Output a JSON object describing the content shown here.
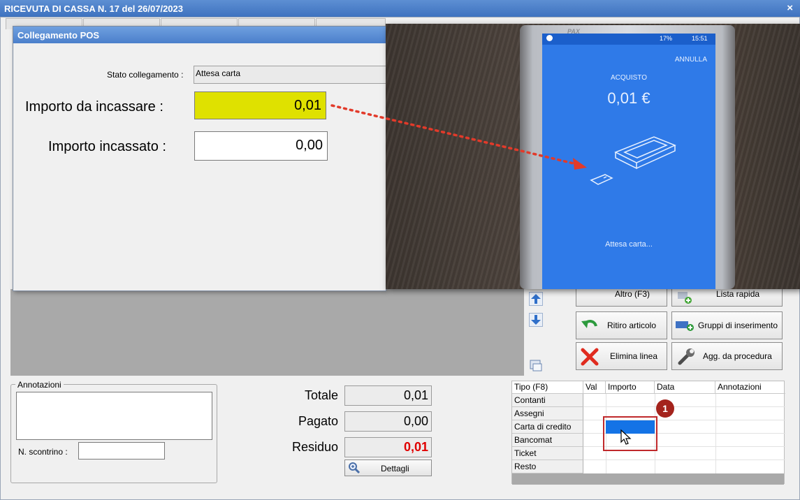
{
  "main_window": {
    "title": "RICEVUTA DI CASSA N. 17 del 26/07/2023",
    "close_glyph": "×"
  },
  "pos_dialog": {
    "title": "Collegamento POS",
    "stato_label": "Stato collegamento :",
    "stato_value": "Attesa carta",
    "importo_incassare_label": "Importo da incassare :",
    "importo_incassare_value": "0,01",
    "importo_incassato_label": "Importo incassato :",
    "importo_incassato_value": "0,00"
  },
  "phone": {
    "brand": "PAX",
    "status_time": "15:51",
    "status_battery": "17%",
    "annulla": "ANNULLA",
    "acquisto": "ACQUISTO",
    "amount": "0,01 €",
    "waiting": "Attesa carta..."
  },
  "buttons": {
    "altro": "Altro (F3)",
    "lista_rapida": "Lista rapida",
    "ritiro_articolo": "Ritiro articolo",
    "gruppi": "Gruppi di inserimento",
    "elimina_linea": "Elimina linea",
    "agg_procedura": "Agg. da procedura",
    "dettagli": "Dettagli"
  },
  "annotazioni": {
    "legend": "Annotazioni",
    "scontrino_label": "N. scontrino :"
  },
  "totals": {
    "totale_label": "Totale",
    "totale_value": "0,01",
    "pagato_label": "Pagato",
    "pagato_value": "0,00",
    "residuo_label": "Residuo",
    "residuo_value": "0,01",
    "residuo_color": "#e00000"
  },
  "payment_grid": {
    "headers": [
      "Tipo (F8)",
      "Val",
      "Importo",
      "Data",
      "Annotazioni"
    ],
    "rows": [
      "Contanti",
      "Assegni",
      "Carta di credito",
      "Bancomat",
      "Ticket",
      "Resto"
    ]
  },
  "annotation_badge": "1",
  "colors": {
    "highlight_yellow": "#dfe100",
    "selection_blue": "#1473e6",
    "callout_red": "#c0292b",
    "pos_screen_blue": "#2f7ae8"
  }
}
